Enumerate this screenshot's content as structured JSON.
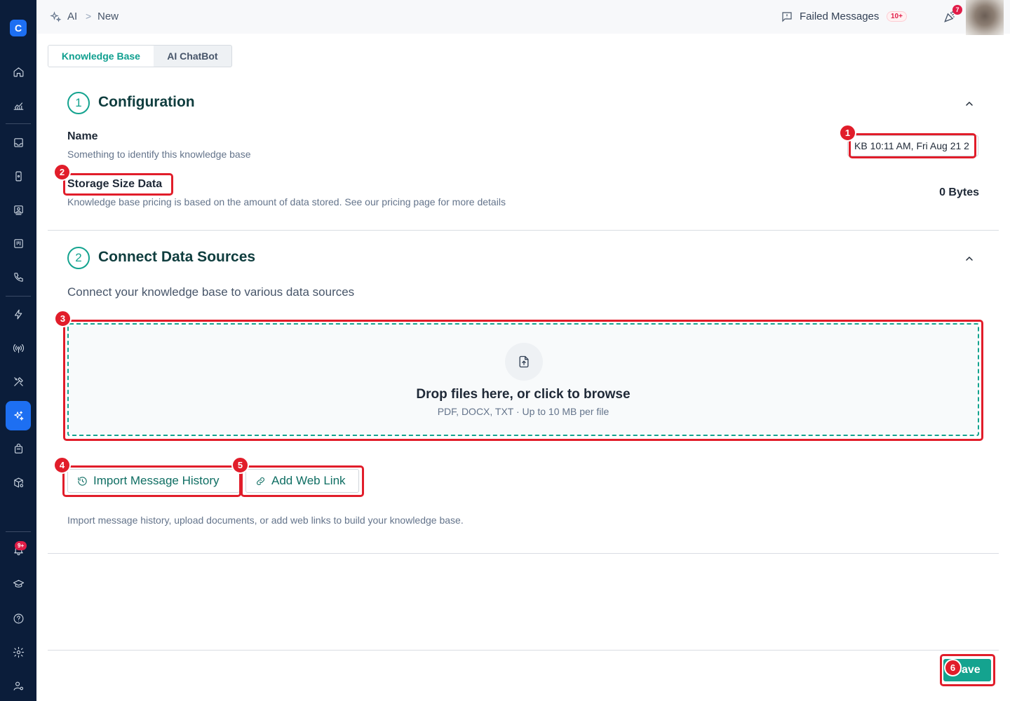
{
  "breadcrumb": {
    "root": "AI",
    "separator": ">",
    "current": "New"
  },
  "header": {
    "failed_messages_label": "Failed Messages",
    "failed_messages_badge": "10+",
    "notifications_badge": "7"
  },
  "sidebar": {
    "logo": "C",
    "alerts_badge": "9+"
  },
  "tabs": [
    {
      "label": "Knowledge Base",
      "active": true
    },
    {
      "label": "AI ChatBot",
      "active": false
    }
  ],
  "configuration": {
    "step": "1",
    "title": "Configuration",
    "name_label": "Name",
    "name_description": "Something to identify this knowledge base",
    "name_value": "KB 10:11 AM, Fri Aug 21 2",
    "storage_label": "Storage Size Data",
    "storage_description": "Knowledge base pricing is based on the amount of data stored. See our pricing page for more details",
    "storage_value": "0 Bytes"
  },
  "data_sources": {
    "step": "2",
    "title": "Connect Data Sources",
    "description": "Connect your knowledge base to various data sources",
    "drop_title": "Drop files here, or click to browse",
    "drop_subtitle": "PDF, DOCX, TXT  ·  Up to 10 MB per file",
    "import_button": "Import Message History",
    "web_link_button": "Add Web Link",
    "helper_text": "Import message history, upload documents, or add web links to build your knowledge base."
  },
  "footer": {
    "save_label": "Save"
  },
  "annotations": [
    "1",
    "2",
    "3",
    "4",
    "5",
    "6"
  ],
  "colors": {
    "accent": "#14a38f",
    "sidebar": "#0b1d3a",
    "active_nav": "#1d6ff2",
    "annotation": "#e11d2a"
  }
}
